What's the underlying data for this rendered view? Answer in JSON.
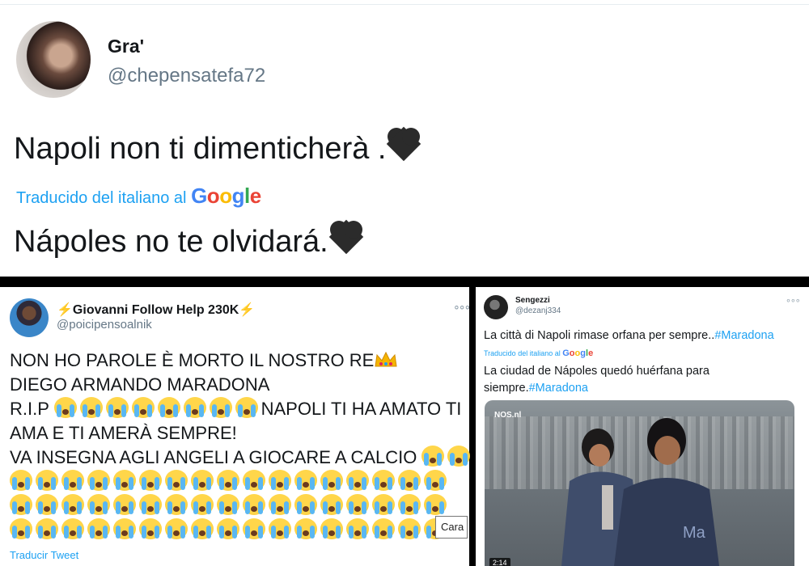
{
  "top_tweet": {
    "author_name": "Gra'",
    "author_handle": "@chepensatefa72",
    "text": "Napoli non ti dimenticherà .",
    "translation_link": "Traducido del italiano al ",
    "translation_provider": "Google",
    "translated_text": "Nápoles no te olvidará.",
    "icons": [
      "black-heart-icon"
    ]
  },
  "bottom_left_tweet": {
    "author_name": "Giovanni Follow Help 230K",
    "author_handle": "@poicipensoalnik",
    "more_label": "∘∘∘",
    "lines": {
      "l1": "NON HO PAROLE È MORTO IL NOSTRO RE",
      "l2": "DIEGO ARMANDO MARADONA",
      "l3a": "R.I.P ",
      "l3b": "NAPOLI TI HA AMATO TI",
      "l4": "AMA E TI AMERÀ SEMPRE!",
      "l5": "VA INSEGNA AGLI ANGELI A GIOCARE A CALCIO "
    },
    "tooltip": "Cara",
    "translate_label": "Traducir Tweet",
    "icons": [
      "lightning-icon",
      "crown-icon",
      "crying-face-icon"
    ]
  },
  "bottom_right_tweet": {
    "author_name": "Sengezzi",
    "author_handle": "@dezanj334",
    "more_label": "∘∘∘",
    "text": "La città di Napoli rimase orfana per sempre..",
    "hashtag": "#Maradona",
    "translation_link": "Traducido del italiano al ",
    "translation_provider": "Google",
    "translated_text": "La ciudad de Nápoles quedó huérfana para siempre.",
    "translated_hashtag": "#Maradona",
    "video_watermark": "NOS.nl",
    "video_duration": "2:14"
  },
  "colors": {
    "link": "#1da1f2",
    "text": "#14171a",
    "secondary": "#657786",
    "separator": "#000000"
  }
}
